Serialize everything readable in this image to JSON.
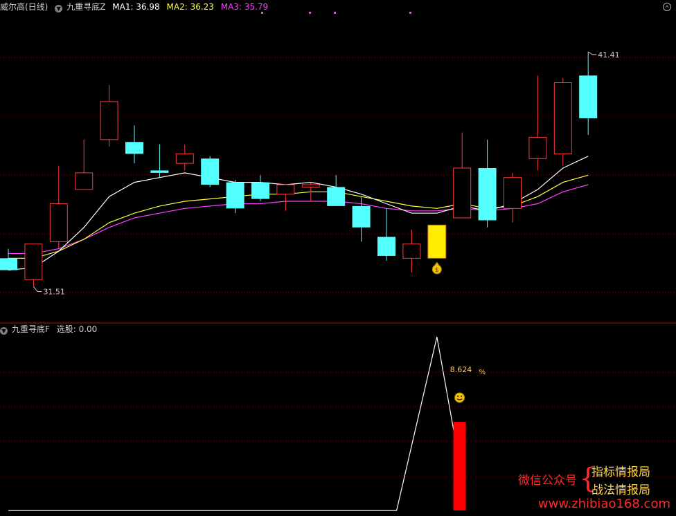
{
  "top_panel": {
    "stock_name": "威尔高(日线)",
    "indicator_name": "九重寻底Z",
    "ma1_label": "MA1: 36.98",
    "ma2_label": "MA2: 36.23",
    "ma3_label": "MA3: 35.79",
    "high_label": "41.41",
    "low_label": "31.51"
  },
  "bottom_panel": {
    "indicator_name": "九重寻底F",
    "value_label": "选股: 0.00",
    "pct_label": "8.624",
    "pct_sign": "%"
  },
  "watermark": {
    "left_text": "微信公众号",
    "line1": "指标情报局",
    "line2": "战法情报局",
    "site": "www.zhibiao168.com"
  },
  "colors": {
    "up": "#ff3c3c",
    "down": "#54ffff",
    "ma1": "#ffffff",
    "ma2": "#ffff40",
    "ma3": "#ff40ff",
    "grid": "#8b0000",
    "signal": "#ffee00"
  },
  "chart_data": {
    "type": "candlestick",
    "price_range": [
      30,
      43
    ],
    "candles": [
      {
        "o": 32.7,
        "c": 32.2,
        "h": 33.1,
        "l": 32.2
      },
      {
        "o": 31.8,
        "c": 33.3,
        "h": 33.3,
        "l": 31.5
      },
      {
        "o": 33.4,
        "c": 35.0,
        "h": 36.6,
        "l": 33.1
      },
      {
        "o": 35.6,
        "c": 36.3,
        "h": 37.7,
        "l": 35.6
      },
      {
        "o": 37.7,
        "c": 39.3,
        "h": 40.0,
        "l": 37.4
      },
      {
        "o": 37.6,
        "c": 37.1,
        "h": 38.3,
        "l": 36.7
      },
      {
        "o": 36.4,
        "c": 36.3,
        "h": 37.5,
        "l": 36.1
      },
      {
        "o": 36.7,
        "c": 37.1,
        "h": 37.5,
        "l": 36.4
      },
      {
        "o": 36.9,
        "c": 35.8,
        "h": 37.0,
        "l": 35.7
      },
      {
        "o": 35.9,
        "c": 34.8,
        "h": 36.0,
        "l": 34.6
      },
      {
        "o": 35.9,
        "c": 35.2,
        "h": 36.2,
        "l": 35.1
      },
      {
        "o": 35.4,
        "c": 35.8,
        "h": 35.8,
        "l": 34.7
      },
      {
        "o": 35.7,
        "c": 35.8,
        "h": 35.9,
        "l": 35.1
      },
      {
        "o": 35.7,
        "c": 34.9,
        "h": 36.2,
        "l": 34.9
      },
      {
        "o": 34.9,
        "c": 34.0,
        "h": 35.3,
        "l": 33.4
      },
      {
        "o": 33.6,
        "c": 32.8,
        "h": 34.8,
        "l": 32.6
      },
      {
        "o": 32.7,
        "c": 33.3,
        "h": 33.9,
        "l": 32.1
      },
      {
        "o": 32.7,
        "c": 34.1,
        "h": 34.1,
        "l": 32.7
      },
      {
        "o": 34.4,
        "c": 36.5,
        "h": 38.0,
        "l": 34.4
      },
      {
        "o": 36.5,
        "c": 34.3,
        "h": 37.7,
        "l": 34.0
      },
      {
        "o": 34.8,
        "c": 36.1,
        "h": 36.3,
        "l": 34.2
      },
      {
        "o": 36.9,
        "c": 37.8,
        "h": 40.4,
        "l": 36.4
      },
      {
        "o": 37.1,
        "c": 40.1,
        "h": 40.3,
        "l": 36.6
      },
      {
        "o": 40.4,
        "c": 38.6,
        "h": 41.4,
        "l": 37.9
      }
    ],
    "signal_candle_index": 17,
    "ma1": [
      32.2,
      32.3,
      33.0,
      34.0,
      35.3,
      35.9,
      36.1,
      36.3,
      36.1,
      35.9,
      35.9,
      35.8,
      35.9,
      35.7,
      35.4,
      35.0,
      34.6,
      34.6,
      34.9,
      34.7,
      35.0,
      35.6,
      36.5,
      37.0
    ],
    "ma2": [
      32.7,
      32.7,
      33.0,
      33.5,
      34.2,
      34.6,
      34.9,
      35.1,
      35.2,
      35.3,
      35.4,
      35.4,
      35.5,
      35.5,
      35.3,
      35.1,
      34.9,
      34.8,
      35.0,
      34.8,
      34.9,
      35.3,
      35.9,
      36.2
    ],
    "ma3": [
      32.9,
      32.9,
      33.1,
      33.5,
      34.0,
      34.4,
      34.6,
      34.8,
      34.9,
      35.0,
      35.0,
      35.1,
      35.1,
      35.1,
      35.0,
      34.8,
      34.7,
      34.7,
      34.8,
      34.7,
      34.8,
      35.0,
      35.5,
      35.8
    ],
    "bottom": {
      "value_range": [
        0,
        100
      ],
      "line_points": [
        {
          "i": 0,
          "v": 0
        },
        {
          "i": 15.4,
          "v": 0
        },
        {
          "i": 17.0,
          "v": 100
        },
        {
          "i": 17.9,
          "v": 27
        }
      ],
      "bar_index": 17.9,
      "bar_value": 51,
      "smiley_index": 17.9,
      "smiley_value": 65
    }
  }
}
